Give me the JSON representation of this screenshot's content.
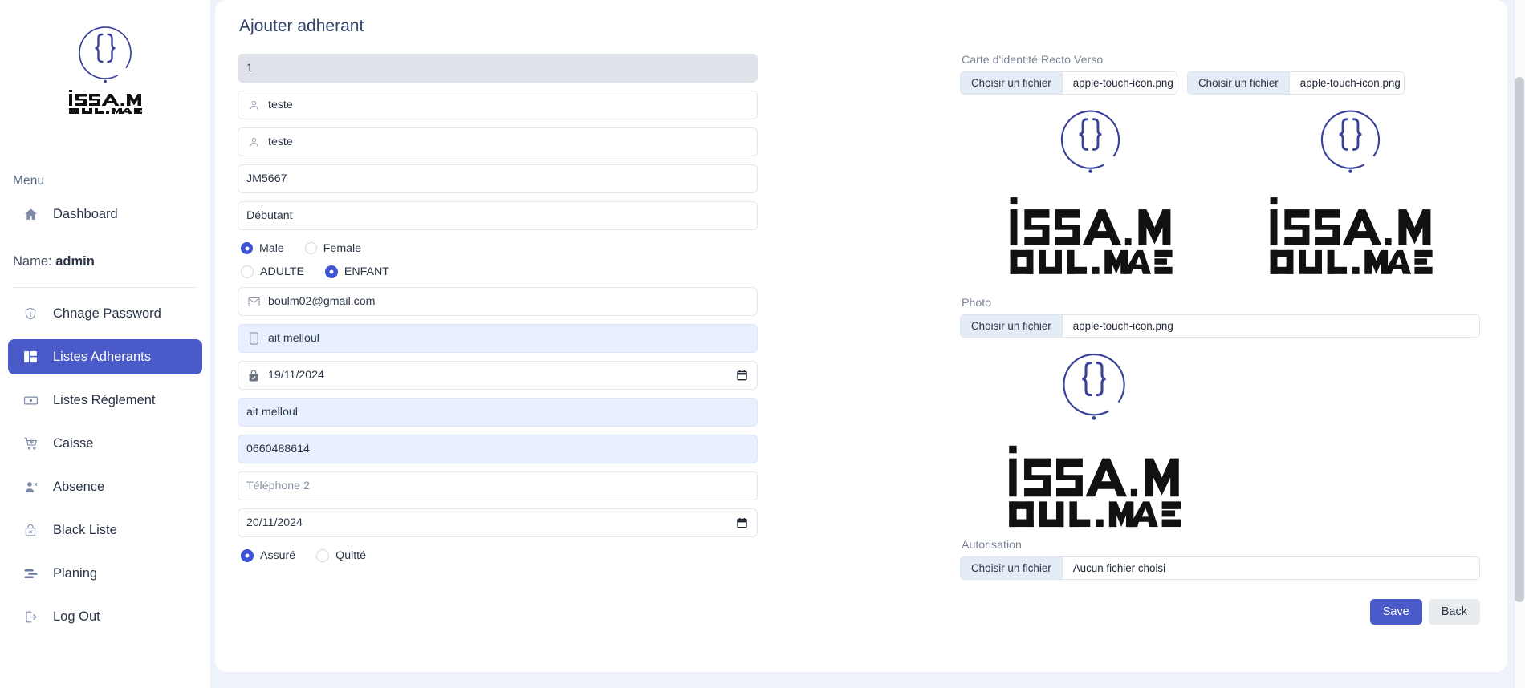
{
  "brand": {
    "name_line1": "ISSAM",
    "name_line2": "BOULMANE"
  },
  "sidebar": {
    "menu_label": "Menu",
    "dashboard": {
      "label": "Dashboard",
      "icon": "home-icon"
    },
    "name_prefix": "Name:",
    "name_value": "admin",
    "items": [
      {
        "label": "Chnage Password",
        "icon": "shield-icon",
        "active": false
      },
      {
        "label": "Listes Adherants",
        "icon": "dashboard-grid-icon",
        "active": true
      },
      {
        "label": "Listes Réglement",
        "icon": "banknote-icon",
        "active": false
      },
      {
        "label": "Caisse",
        "icon": "cart-plus-icon",
        "active": false
      },
      {
        "label": "Absence",
        "icon": "user-minus-icon",
        "active": false
      },
      {
        "label": "Black Liste",
        "icon": "bag-x-icon",
        "active": false
      },
      {
        "label": "Planing",
        "icon": "list-filter-icon",
        "active": false
      },
      {
        "label": "Log Out",
        "icon": "logout-icon",
        "active": false
      }
    ]
  },
  "page": {
    "title": "Ajouter adherant"
  },
  "form": {
    "id_field": {
      "value": "1",
      "icon": "none",
      "state": "readonly"
    },
    "first_name": {
      "value": "teste",
      "icon": "user-icon",
      "state": "normal"
    },
    "last_name": {
      "value": "teste",
      "icon": "user-icon",
      "state": "normal"
    },
    "cin": {
      "value": "JM5667",
      "icon": "none",
      "state": "normal"
    },
    "level": {
      "value": "Débutant",
      "icon": "none",
      "state": "normal"
    },
    "gender": {
      "options": [
        {
          "label": "Male",
          "selected": true
        },
        {
          "label": "Female",
          "selected": false
        }
      ]
    },
    "category": {
      "options": [
        {
          "label": "ADULTE",
          "selected": false
        },
        {
          "label": "ENFANT",
          "selected": true
        }
      ]
    },
    "email": {
      "value": "boulm02@gmail.com",
      "icon": "envelope-icon",
      "state": "normal"
    },
    "address1": {
      "value": "ait melloul",
      "icon": "phone-icon",
      "state": "autofill"
    },
    "date_start": {
      "value": "19/11/2024",
      "icon": "lock-check-icon",
      "state": "normal",
      "has_calendar": true
    },
    "address2": {
      "value": "ait melloul",
      "icon": "none",
      "state": "autofill"
    },
    "phone1": {
      "value": "0660488614",
      "icon": "none",
      "state": "autofill"
    },
    "phone2": {
      "value": "",
      "placeholder": "Téléphone 2",
      "icon": "none",
      "state": "normal"
    },
    "date_end": {
      "value": "20/11/2024",
      "icon": "none",
      "state": "normal",
      "has_calendar": true
    },
    "status": {
      "options": [
        {
          "label": "Assuré",
          "selected": true
        },
        {
          "label": "Quitté",
          "selected": false
        }
      ]
    }
  },
  "uploads": {
    "cin_label": "Carte d'identité Recto Verso",
    "cin_recto": {
      "button": "Choisir un fichier",
      "filename": "apple-touch-icon.png"
    },
    "cin_verso": {
      "button": "Choisir un fichier",
      "filename": "apple-touch-icon.png"
    },
    "photo_label": "Photo",
    "photo": {
      "button": "Choisir un fichier",
      "filename": "apple-touch-icon.png"
    },
    "autorisation_label": "Autorisation",
    "autorisation": {
      "button": "Choisir un fichier",
      "filename": "Aucun fichier choisi"
    }
  },
  "actions": {
    "save": "Save",
    "back": "Back"
  },
  "colors": {
    "accent": "#4a5ac9",
    "radio_on": "#3b53d4",
    "sidebar_bg": "#ffffff",
    "page_bg": "#eef2fb",
    "autofill": "#e8f0fe",
    "readonly": "#dfe3e9",
    "logo_ink": "#39419a"
  }
}
